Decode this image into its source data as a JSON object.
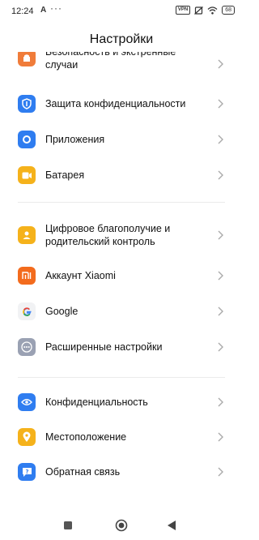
{
  "status": {
    "time": "12:24",
    "notif": "A",
    "dots": "···",
    "vpn": "VPN",
    "battery": "68"
  },
  "header": {
    "title": "Настройки"
  },
  "items": [
    {
      "label": "Безопасность и экстренные случаи",
      "icon": "security-icon"
    },
    {
      "label": "Защита конфиденциальности",
      "icon": "privacy-shield-icon"
    },
    {
      "label": "Приложения",
      "icon": "apps-icon"
    },
    {
      "label": "Батарея",
      "icon": "battery-icon"
    },
    {
      "label": "Цифровое благополучие и родительский контроль",
      "icon": "wellbeing-icon"
    },
    {
      "label": "Аккаунт Xiaomi",
      "icon": "xiaomi-logo-icon"
    },
    {
      "label": "Google",
      "icon": "google-icon"
    },
    {
      "label": "Расширенные настройки",
      "icon": "more-settings-icon"
    },
    {
      "label": "Конфиденциальность",
      "icon": "eye-icon"
    },
    {
      "label": "Местоположение",
      "icon": "location-icon"
    },
    {
      "label": "Обратная связь",
      "icon": "feedback-icon"
    }
  ],
  "colors": {
    "security": "#f07c3a",
    "privacy": "#2f7df0",
    "apps": "#2f7df0",
    "battery": "#f5b21b",
    "wellbeing": "#f5b21b",
    "xiaomi": "#f36b1d",
    "more": "#9aa1b3",
    "eye": "#2f7df0",
    "location": "#f5b21b",
    "feedback": "#2f7df0"
  },
  "nav": {
    "recents": "recents-button",
    "home": "home-button",
    "back": "back-button"
  }
}
